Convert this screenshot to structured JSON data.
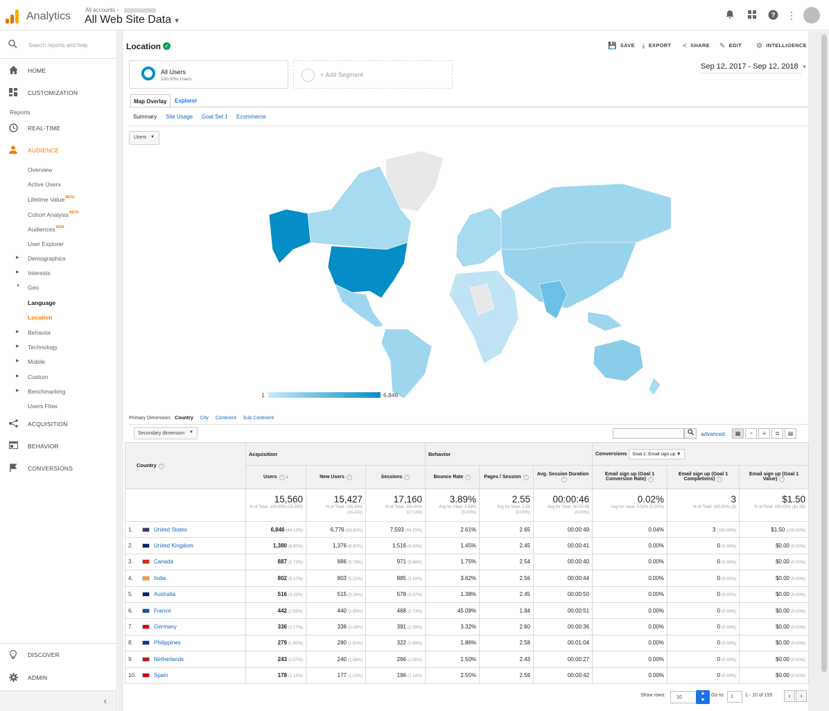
{
  "header": {
    "app_name": "Analytics",
    "breadcrumb": "All accounts",
    "account_name": "All Web Site Data",
    "logo_colors": [
      "#f9ab00",
      "#e37400",
      "#e37400"
    ]
  },
  "sidebar": {
    "search_placeholder": "Search reports and help",
    "home": "HOME",
    "customization": "CUSTOMIZATION",
    "reports_label": "Reports",
    "realtime": "REAL-TIME",
    "audience": "AUDIENCE",
    "audience_items": [
      {
        "label": "Overview"
      },
      {
        "label": "Active Users"
      },
      {
        "label": "Lifetime Value",
        "badge": "BETA"
      },
      {
        "label": "Cohort Analysis",
        "badge": "BETA"
      },
      {
        "label": "Audiences",
        "badge": "NEW"
      },
      {
        "label": "User Explorer"
      },
      {
        "label": "Demographics"
      },
      {
        "label": "Interests"
      },
      {
        "label": "Geo"
      },
      {
        "label": "Language"
      },
      {
        "label": "Location"
      },
      {
        "label": "Behavior"
      },
      {
        "label": "Technology"
      },
      {
        "label": "Mobile"
      },
      {
        "label": "Custom"
      },
      {
        "label": "Benchmarking"
      },
      {
        "label": "Users Flow"
      }
    ],
    "acquisition": "ACQUISITION",
    "behavior": "BEHAVIOR",
    "conversions": "CONVERSIONS",
    "discover": "DISCOVER",
    "admin": "ADMIN",
    "active_color": "#f57c00"
  },
  "page": {
    "title": "Location",
    "toolbar": {
      "save": "SAVE",
      "export": "EXPORT",
      "share": "SHARE",
      "edit": "EDIT",
      "intelligence": "INTELLIGENCE"
    },
    "segment": {
      "name": "All Users",
      "pct": "100.00% Users",
      "add": "+ Add Segment"
    },
    "date_range": "Sep 12, 2017 - Sep 12, 2018",
    "tabs": {
      "map": "Map Overlay",
      "explorer": "Explorer"
    },
    "subtabs": [
      "Summary",
      "Site Usage",
      "Goal Set 1",
      "Ecommerce"
    ],
    "metric": "Users",
    "legend": {
      "min": "1",
      "max": "6,846"
    },
    "primary_dimension": {
      "label": "Primary Dimension:",
      "current": "Country",
      "options": [
        "City",
        "Continent",
        "Sub Continent"
      ]
    },
    "secondary_dimension": "Secondary dimension",
    "advanced": "advanced",
    "accent_color": "#058dc7"
  },
  "table": {
    "country_header": "Country",
    "groups": {
      "acquisition": "Acquisition",
      "behavior": "Behavior",
      "conversions": "Conversions",
      "goal_select": "Goal 1: Email sign up"
    },
    "columns": [
      "Users",
      "New Users",
      "Sessions",
      "Bounce Rate",
      "Pages / Session",
      "Avg. Session Duration",
      "Email sign up (Goal 1 Conversion Rate)",
      "Email sign up (Goal 1 Completions)",
      "Email sign up (Goal 1 Value)"
    ],
    "totals": [
      {
        "value": "15,560",
        "sub": "% of Total: 100.00% (15,560)"
      },
      {
        "value": "15,427",
        "sub": "% of Total: 100.04% (15,421)"
      },
      {
        "value": "17,160",
        "sub": "% of Total: 100.00% (17,160)"
      },
      {
        "value": "3.89%",
        "sub": "Avg for View: 3.89% (0.00%)"
      },
      {
        "value": "2.55",
        "sub": "Avg for View: 2.55 (0.00%)"
      },
      {
        "value": "00:00:46",
        "sub": "Avg for View: 00:00:46 (0.00%)"
      },
      {
        "value": "0.02%",
        "sub": "Avg for View: 0.02% (0.00%)"
      },
      {
        "value": "3",
        "sub": "% of Total: 100.00% (3)"
      },
      {
        "value": "$1.50",
        "sub": "% of Total: 100.00% ($1.50)"
      }
    ],
    "rows": [
      {
        "n": "1.",
        "country": "United States",
        "flag": "#3c3b6e",
        "users": "6,846",
        "users_pct": "(44.13%)",
        "new": "6,776",
        "new_pct": "(43.92%)",
        "sess": "7,593",
        "sess_pct": "(44.25%)",
        "bounce": "2.61%",
        "pps": "2.65",
        "dur": "00:00:49",
        "conv": "0.04%",
        "comp": "3",
        "comp_pct": "(100.00%)",
        "val": "$1.50",
        "val_pct": "(100.00%)"
      },
      {
        "n": "2.",
        "country": "United Kingdom",
        "flag": "#012169",
        "users": "1,380",
        "users_pct": "(8.90%)",
        "new": "1,376",
        "new_pct": "(8.92%)",
        "sess": "1,516",
        "sess_pct": "(8.83%)",
        "bounce": "1.45%",
        "pps": "2.45",
        "dur": "00:00:41",
        "conv": "0.00%",
        "comp": "0",
        "comp_pct": "(0.00%)",
        "val": "$0.00",
        "val_pct": "(0.00%)"
      },
      {
        "n": "3.",
        "country": "Canada",
        "flag": "#d52b1e",
        "users": "887",
        "users_pct": "(5.72%)",
        "new": "886",
        "new_pct": "(5.74%)",
        "sess": "971",
        "sess_pct": "(5.66%)",
        "bounce": "1.75%",
        "pps": "2.54",
        "dur": "00:00:40",
        "conv": "0.00%",
        "comp": "0",
        "comp_pct": "(0.00%)",
        "val": "$0.00",
        "val_pct": "(0.00%)"
      },
      {
        "n": "4.",
        "country": "India",
        "flag": "#ff9933",
        "users": "802",
        "users_pct": "(5.17%)",
        "new": "803",
        "new_pct": "(5.21%)",
        "sess": "885",
        "sess_pct": "(5.16%)",
        "bounce": "3.62%",
        "pps": "2.56",
        "dur": "00:00:44",
        "conv": "0.00%",
        "comp": "0",
        "comp_pct": "(0.00%)",
        "val": "$0.00",
        "val_pct": "(0.00%)"
      },
      {
        "n": "5.",
        "country": "Australia",
        "flag": "#00247d",
        "users": "516",
        "users_pct": "(3.33%)",
        "new": "515",
        "new_pct": "(3.34%)",
        "sess": "578",
        "sess_pct": "(3.37%)",
        "bounce": "1.38%",
        "pps": "2.45",
        "dur": "00:00:50",
        "conv": "0.00%",
        "comp": "0",
        "comp_pct": "(0.00%)",
        "val": "$0.00",
        "val_pct": "(0.00%)"
      },
      {
        "n": "6.",
        "country": "France",
        "flag": "#0055a4",
        "users": "442",
        "users_pct": "(2.85%)",
        "new": "440",
        "new_pct": "(2.85%)",
        "sess": "468",
        "sess_pct": "(2.73%)",
        "bounce": "45.09%",
        "pps": "1.84",
        "dur": "00:00:51",
        "conv": "0.00%",
        "comp": "0",
        "comp_pct": "(0.00%)",
        "val": "$0.00",
        "val_pct": "(0.00%)"
      },
      {
        "n": "7.",
        "country": "Germany",
        "flag": "#dd0000",
        "users": "336",
        "users_pct": "(2.17%)",
        "new": "336",
        "new_pct": "(2.18%)",
        "sess": "391",
        "sess_pct": "(2.28%)",
        "bounce": "3.32%",
        "pps": "2.60",
        "dur": "00:00:36",
        "conv": "0.00%",
        "comp": "0",
        "comp_pct": "(0.00%)",
        "val": "$0.00",
        "val_pct": "(0.00%)"
      },
      {
        "n": "8.",
        "country": "Philippines",
        "flag": "#0038a8",
        "users": "279",
        "users_pct": "(1.80%)",
        "new": "280",
        "new_pct": "(1.81%)",
        "sess": "322",
        "sess_pct": "(1.88%)",
        "bounce": "1.86%",
        "pps": "2.58",
        "dur": "00:01:04",
        "conv": "0.00%",
        "comp": "0",
        "comp_pct": "(0.00%)",
        "val": "$0.00",
        "val_pct": "(0.00%)"
      },
      {
        "n": "9.",
        "country": "Netherlands",
        "flag": "#ae1c28",
        "users": "243",
        "users_pct": "(1.57%)",
        "new": "240",
        "new_pct": "(1.56%)",
        "sess": "266",
        "sess_pct": "(1.55%)",
        "bounce": "1.50%",
        "pps": "2.43",
        "dur": "00:00:27",
        "conv": "0.00%",
        "comp": "0",
        "comp_pct": "(0.00%)",
        "val": "$0.00",
        "val_pct": "(0.00%)"
      },
      {
        "n": "10.",
        "country": "Spain",
        "flag": "#c60b1e",
        "users": "178",
        "users_pct": "(1.15%)",
        "new": "177",
        "new_pct": "(1.15%)",
        "sess": "196",
        "sess_pct": "(1.14%)",
        "bounce": "2.55%",
        "pps": "2.59",
        "dur": "00:00:42",
        "conv": "0.00%",
        "comp": "0",
        "comp_pct": "(0.00%)",
        "val": "$0.00",
        "val_pct": "(0.00%)"
      }
    ]
  },
  "pager": {
    "show_rows": "Show rows:",
    "rows": "10",
    "goto": "Go to:",
    "page": "1",
    "range": "1 - 10 of 155"
  }
}
